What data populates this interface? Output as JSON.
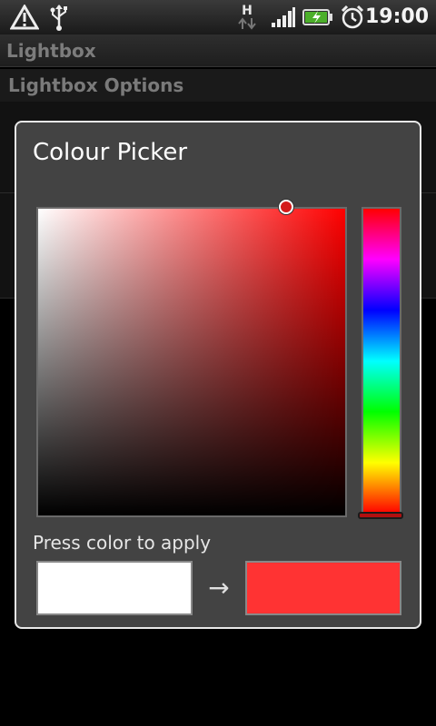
{
  "status_bar": {
    "time": "19:00",
    "network_label": "H",
    "icons": [
      "warning-icon",
      "usb-icon",
      "data-arrows-icon",
      "signal-icon",
      "battery-charging-icon",
      "alarm-clock-icon"
    ]
  },
  "app": {
    "title": "Lightbox",
    "section_header": "Lightbox Options"
  },
  "dialog": {
    "title": "Colour Picker",
    "hint": "Press color to apply",
    "old_color": "#ffffff",
    "new_color": "#ff3333",
    "arrow": "→"
  },
  "colors": {
    "dialog_bg": "#434343",
    "dialog_border": "#e8e8e8",
    "status_bar_bg": "#2a2a2a"
  }
}
